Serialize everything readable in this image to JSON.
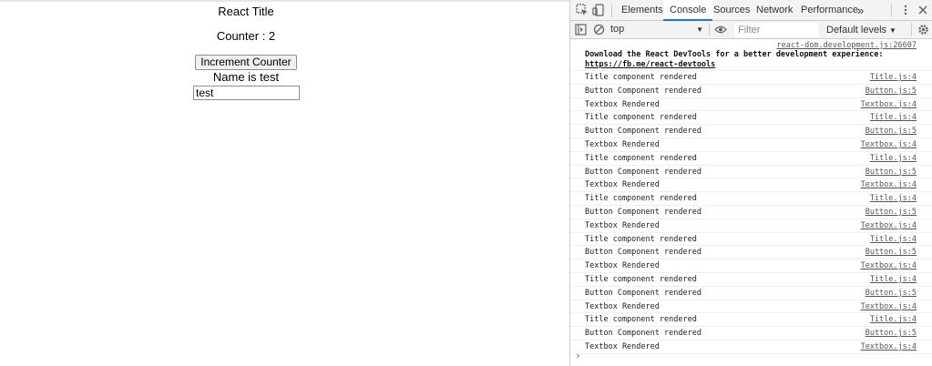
{
  "app": {
    "title": "React Title",
    "counter_text": "Counter : 2",
    "increment_label": "Increment Counter",
    "name_text": "Name is test",
    "name_value": "test"
  },
  "devtools": {
    "tabs": [
      "Elements",
      "Console",
      "Sources",
      "Network",
      "Performance"
    ],
    "active_tab": "Console",
    "more_tabs": "»",
    "context": "top",
    "filter_placeholder": "Filter",
    "levels": "Default levels",
    "colors": {
      "accent": "#1a73e8",
      "toolbar_bg": "#f3f3f3"
    },
    "console": {
      "devtools_source": "react-dom.development.js:26607",
      "devtools_msg_pre": "Download the React DevTools for a better development experience: ",
      "devtools_link": "https://fb.me/react-devtools",
      "logs": [
        {
          "msg": "Title component rendered",
          "src": "Title.js:4"
        },
        {
          "msg": "Button Component rendered",
          "src": "Button.js:5"
        },
        {
          "msg": "Textbox Rendered",
          "src": "Textbox.js:4"
        },
        {
          "msg": "Title component rendered",
          "src": "Title.js:4"
        },
        {
          "msg": "Button Component rendered",
          "src": "Button.js:5"
        },
        {
          "msg": "Textbox Rendered",
          "src": "Textbox.js:4"
        },
        {
          "msg": "Title component rendered",
          "src": "Title.js:4"
        },
        {
          "msg": "Button Component rendered",
          "src": "Button.js:5"
        },
        {
          "msg": "Textbox Rendered",
          "src": "Textbox.js:4"
        },
        {
          "msg": "Title component rendered",
          "src": "Title.js:4"
        },
        {
          "msg": "Button Component rendered",
          "src": "Button.js:5"
        },
        {
          "msg": "Textbox Rendered",
          "src": "Textbox.js:4"
        },
        {
          "msg": "Title component rendered",
          "src": "Title.js:4"
        },
        {
          "msg": "Button Component rendered",
          "src": "Button.js:5"
        },
        {
          "msg": "Textbox Rendered",
          "src": "Textbox.js:4"
        },
        {
          "msg": "Title component rendered",
          "src": "Title.js:4"
        },
        {
          "msg": "Button Component rendered",
          "src": "Button.js:5"
        },
        {
          "msg": "Textbox Rendered",
          "src": "Textbox.js:4"
        },
        {
          "msg": "Title component rendered",
          "src": "Title.js:4"
        },
        {
          "msg": "Button Component rendered",
          "src": "Button.js:5"
        },
        {
          "msg": "Textbox Rendered",
          "src": "Textbox.js:4"
        }
      ],
      "prompt": "›"
    },
    "icons": [
      "inspect-icon",
      "device-toggle-icon",
      "kebab-menu-icon",
      "close-icon",
      "sidebar-toggle-icon",
      "clear-console-icon",
      "eye-icon",
      "settings-gear-icon"
    ]
  }
}
